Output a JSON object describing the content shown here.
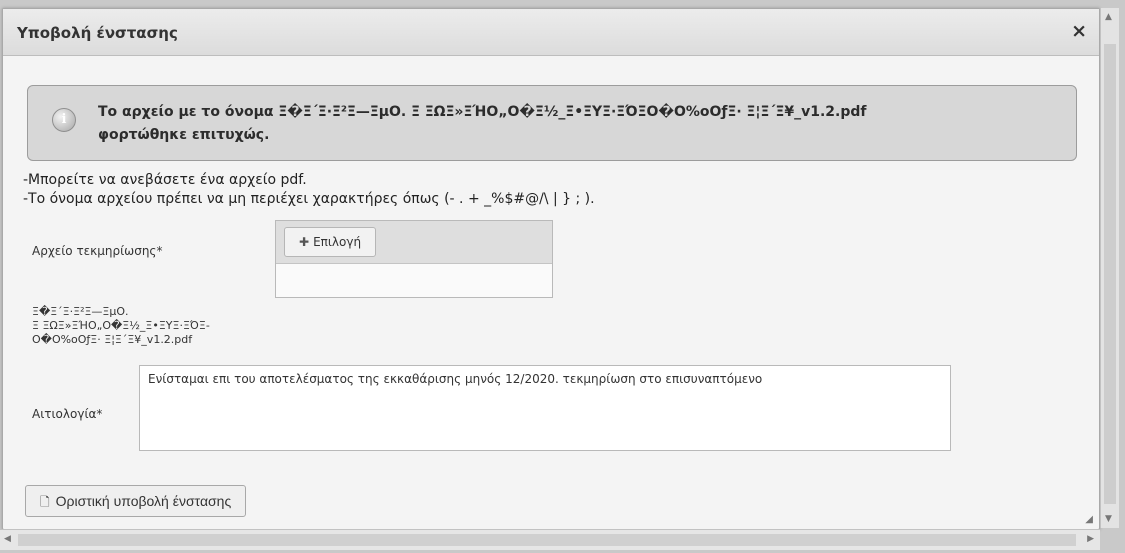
{
  "dialog": {
    "title": "Υποβολή ένστασης",
    "close_label": "×"
  },
  "message": {
    "line1": "Το αρχείο με το όνομα Ξ�Ξ΄Ξ·Ξ²Ξ—ΞμΟ. Ξ ΞΩΞ»ΞΉΟ„Ο�Ξ½_Ξ•ΞΥΞ·ΞΌΞΟ�Ο%οΟƒΞ· Ξ¦Ξ΄Ξ¥_v1.2.pdf",
    "line2": "φορτώθηκε επιτυχώς.",
    "icon": "info-icon"
  },
  "hints": {
    "line1": "-Μπορείτε να ανεβάσετε ένα αρχείο pdf.",
    "line2": "-Το όνομα αρχείου πρέπει να μη περιέχει χαρακτήρες όπως (- . + _%$#@/\\ | } ; )."
  },
  "form": {
    "file_label": "Αρχείο τεκμηρίωσης*",
    "choose_label": "Επιλογή",
    "uploaded_name_lines": [
      "Ξ�Ξ΄Ξ·Ξ²Ξ—ΞμΟ.",
      "Ξ ΞΩΞ»ΞΉΟ„Ο�Ξ½_Ξ•ΞΥΞ·ΞΌΞ-",
      "Ο�Ο%οΟƒΞ· Ξ¦Ξ΄Ξ¥_v1.2.pdf"
    ],
    "reason_label": "Αιτιολογία*",
    "reason_value": "Ενίσταμαι επι του αποτελέσματος της εκκαθάρισης μηνός 12/2020. τεκμηρίωση στο επισυναπτόμενο",
    "submit_label": "Οριστική υποβολή ένστασης"
  }
}
